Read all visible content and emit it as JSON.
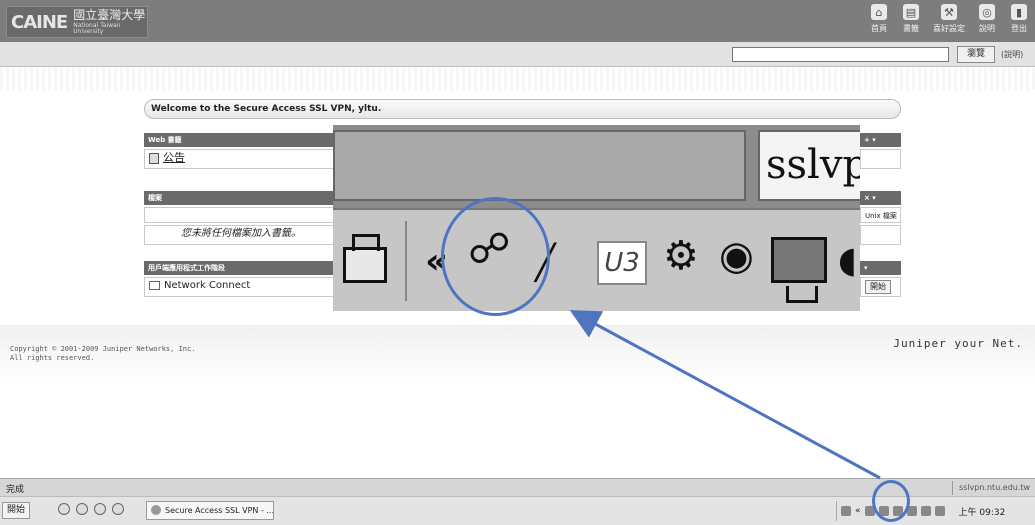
{
  "header": {
    "logo_mark": "CAINE",
    "logo_cn": "國立臺灣大學",
    "logo_en": "National Taiwan University",
    "nav": [
      {
        "label": "首頁",
        "icon": "home-icon"
      },
      {
        "label": "書籤",
        "icon": "bookmark-icon"
      },
      {
        "label": "喜好設定",
        "icon": "wrench-icon"
      },
      {
        "label": "說明",
        "icon": "help-icon"
      },
      {
        "label": "登出",
        "icon": "logout-icon"
      }
    ]
  },
  "browse": {
    "url_value": "",
    "button_label": "瀏覽",
    "help_label": "(說明)"
  },
  "welcome": "Welcome to the Secure Access SSL VPN, yltu.",
  "web_panel": {
    "heading": "Web 書籤",
    "item_label": "公告"
  },
  "files_panel": {
    "heading": "檔案",
    "empty_text": "您未將任何檔案加入書籤。",
    "unix_label": "Unix 檔案"
  },
  "apps_panel": {
    "heading": "用戶端應用程式工作階段",
    "item_label": "Network Connect",
    "start_label": "開始"
  },
  "footer": {
    "copyright_line1": "Copyright © 2001-2009 Juniper Networks, Inc.",
    "copyright_line2": "All rights reserved.",
    "brand": "Juniper your Net."
  },
  "statusbar": {
    "status": "完成",
    "host": "sslvpn.ntu.edu.tw"
  },
  "taskbar": {
    "start_label": "開始",
    "window_label": "Secure Access SSL VPN - ...",
    "clock": "上午 09:32"
  },
  "zoom": {
    "brand_text": "sslvp",
    "u3_label": "U3"
  },
  "colors": {
    "header_bg": "#7d7d7d",
    "callout": "#4e74c2"
  }
}
